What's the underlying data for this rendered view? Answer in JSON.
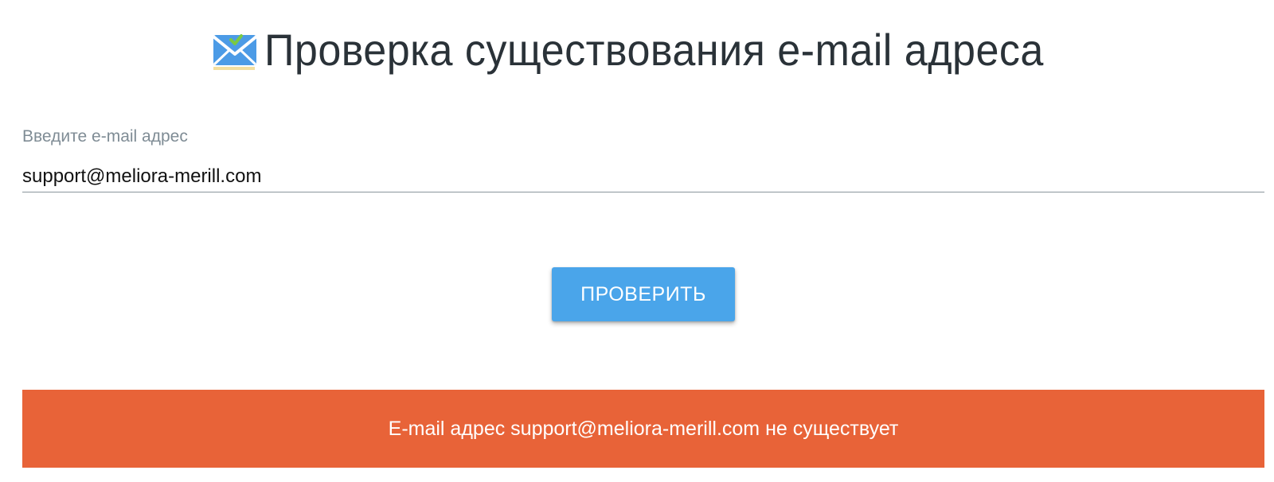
{
  "header": {
    "title": "Проверка существования e-mail адреса",
    "logo_icon": "envelope-check-icon"
  },
  "form": {
    "email_label": "Введите e-mail адрес",
    "email_value": "support@meliora-merill.com",
    "submit_label": "ПРОВЕРИТЬ"
  },
  "result": {
    "message": "E-mail адрес support@meliora-merill.com не существует",
    "status": "error"
  },
  "colors": {
    "button": "#4aa5ea",
    "error_banner": "#e86338",
    "title_text": "#2a3238",
    "label_text": "#7f8c95"
  }
}
